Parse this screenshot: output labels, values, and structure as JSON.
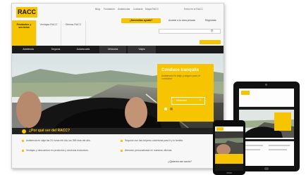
{
  "brand": {
    "logo_text": "RACC",
    "accent": "#f6c400",
    "dark": "#1a1a1a"
  },
  "topnav": {
    "links": [
      "Blog",
      "Fundación",
      "Asistencias",
      "Contacto",
      "Mapa RACC"
    ],
    "right": "Entra en el RACC",
    "cta": "¿Necesitas ayuda?"
  },
  "account_links": [
    "Accede a tu área privada",
    "Regístrate"
  ],
  "subtabs": [
    {
      "label": "Productos y servicios",
      "active": true
    },
    {
      "label": "Ventajas RACC",
      "active": false
    },
    {
      "label": "Ofertas RACC",
      "active": false
    }
  ],
  "mainnav": [
    "Asistencia",
    "Seguros",
    "Autoescuela",
    "Vehículos",
    "Viajes"
  ],
  "hero": {
    "promo_title": "Conduce tranquilo",
    "promo_text": "Asistencia en viaje y seguro para el conductor",
    "promo_button": "Infórmate"
  },
  "section": {
    "question": "¿Por qué ser del RACC?"
  },
  "bullets": [
    "Asistencia en viaje las 24 horas del día, los 365 días del año.",
    "Ventajas y descuentos en productos y servicios exclusivos.",
    "Seguros con las mejores coberturas para ti y tu familia.",
    "Atención personalizada en nuestras oficinas."
  ],
  "bottom_link": "¿Quieres ser socio?"
}
